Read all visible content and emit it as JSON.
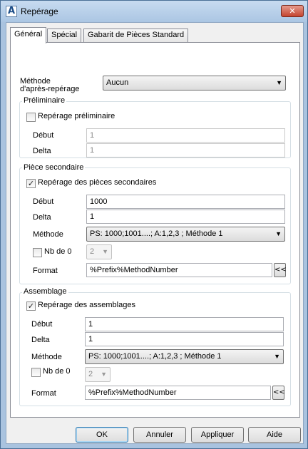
{
  "window": {
    "title": "Repérage",
    "app_icon": "A",
    "close_glyph": "✕"
  },
  "tabs": [
    {
      "label": "Général",
      "active": true
    },
    {
      "label": "Spécial",
      "active": false
    },
    {
      "label": "Gabarit de Pièces Standard",
      "active": false
    }
  ],
  "method_after": {
    "label_line1": "Méthode",
    "label_line2": "d'après-repérage",
    "value": "Aucun"
  },
  "preliminary": {
    "title": "Préliminaire",
    "checkbox_label": "Repérage préliminaire",
    "checked": false,
    "start_label": "Début",
    "start_value": "1",
    "delta_label": "Delta",
    "delta_value": "1"
  },
  "secondary": {
    "title": "Pièce secondaire",
    "checkbox_label": "Repérage des pièces secondaires",
    "checked": true,
    "start_label": "Début",
    "start_value": "1000",
    "delta_label": "Delta",
    "delta_value": "1",
    "method_label": "Méthode",
    "method_value": "PS: 1000;1001....; A:1,2,3 ; Méthode 1",
    "zeros_label": "Nb de 0",
    "zeros_checked": false,
    "zeros_value": "2",
    "format_label": "Format",
    "format_value": "%Prefix%MethodNumber",
    "format_button": "<<"
  },
  "assembly": {
    "title": "Assemblage",
    "checkbox_label": "Repérage des assemblages",
    "checked": true,
    "start_label": "Début",
    "start_value": "1",
    "delta_label": "Delta",
    "delta_value": "1",
    "method_label": "Méthode",
    "method_value": "PS: 1000;1001....; A:1,2,3 ; Méthode 1",
    "zeros_label": "Nb de 0",
    "zeros_checked": false,
    "zeros_value": "2",
    "format_label": "Format",
    "format_value": "%Prefix%MethodNumber",
    "format_button": "<<"
  },
  "buttons": {
    "ok": "OK",
    "cancel": "Annuler",
    "apply": "Appliquer",
    "help": "Aide"
  },
  "glyphs": {
    "check": "✓",
    "dropdown": "▼"
  },
  "icons": {
    "app": "autocad-a-icon",
    "close": "close-icon",
    "dropdown": "chevron-down-icon",
    "check": "checkmark-icon"
  }
}
